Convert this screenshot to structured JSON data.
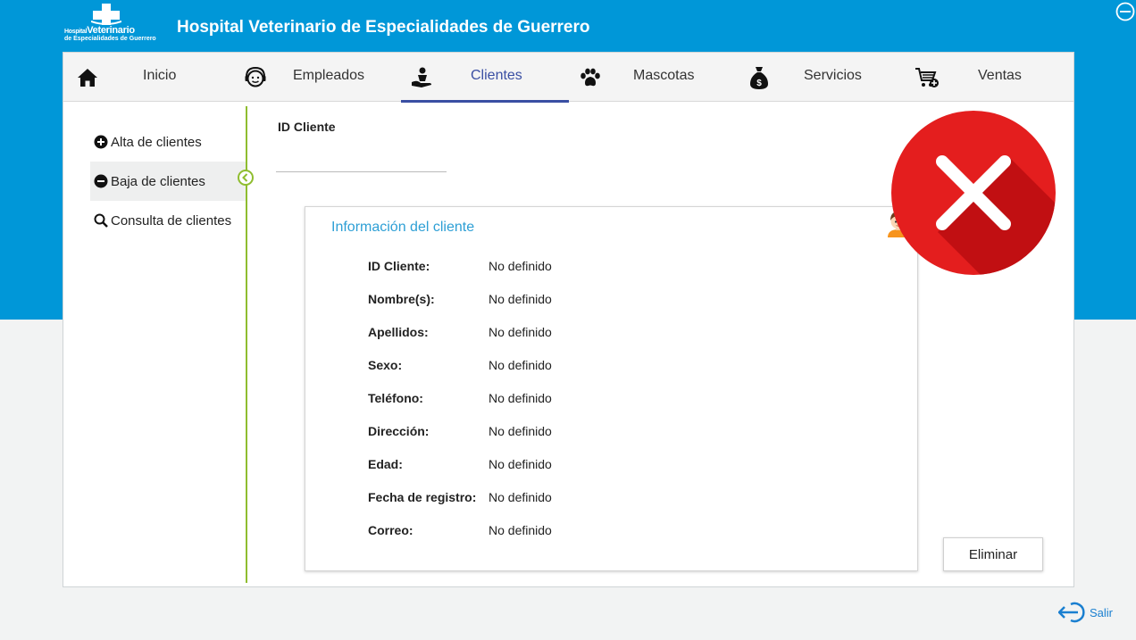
{
  "app": {
    "title": "Hospital Veterinario de Especialidades de Guerrero",
    "logo_line1_small": "Hospital",
    "logo_line1_big": "Veterinario",
    "logo_line2": "de Especialidades de Guerrero"
  },
  "colors": {
    "brand": "#0097d8",
    "active_nav": "#3a4fa3",
    "card_title": "#2d9fd5",
    "sidebar_divider": "#8fbd2f",
    "delete_mark": "#e41e1e"
  },
  "nav": {
    "items": [
      {
        "label": "Inicio",
        "icon": "home-icon"
      },
      {
        "label": "Empleados",
        "icon": "headset-user-icon"
      },
      {
        "label": "Clientes",
        "icon": "client-service-icon",
        "active": true
      },
      {
        "label": "Mascotas",
        "icon": "paw-icon"
      },
      {
        "label": "Servicios",
        "icon": "money-bag-icon"
      },
      {
        "label": "Ventas",
        "icon": "cart-add-icon"
      }
    ]
  },
  "sidebar": {
    "items": [
      {
        "label": "Alta de clientes",
        "icon": "plus-circle-icon"
      },
      {
        "label": "Baja de clientes",
        "icon": "minus-circle-icon",
        "active": true
      },
      {
        "label": "Consulta de clientes",
        "icon": "search-icon"
      }
    ]
  },
  "search": {
    "label": "ID Cliente",
    "value": "",
    "placeholder": ""
  },
  "card": {
    "title": "Información del cliente",
    "rows": [
      {
        "key": "ID Cliente:",
        "value": "No definido"
      },
      {
        "key": "Nombre(s):",
        "value": "No definido"
      },
      {
        "key": "Apellidos:",
        "value": "No definido"
      },
      {
        "key": "Sexo:",
        "value": "No definido"
      },
      {
        "key": "Teléfono:",
        "value": "No definido"
      },
      {
        "key": "Dirección:",
        "value": "No definido"
      },
      {
        "key": "Edad:",
        "value": "No definido"
      },
      {
        "key": "Fecha de registro:",
        "value": "No definido"
      },
      {
        "key": "Correo:",
        "value": "No definido"
      }
    ]
  },
  "actions": {
    "delete_label": "Eliminar",
    "logout_label": "Salir"
  }
}
